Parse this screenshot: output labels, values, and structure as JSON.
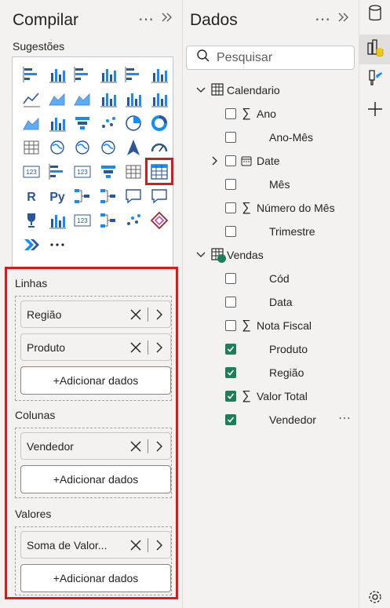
{
  "compilar": {
    "title": "Compilar",
    "suggestions_label": "Sugestões",
    "more_label": "⋯",
    "sections": {
      "linhas": {
        "label": "Linhas",
        "fields": [
          "Região",
          "Produto"
        ]
      },
      "colunas": {
        "label": "Colunas",
        "fields": [
          "Vendedor"
        ]
      },
      "valores": {
        "label": "Valores",
        "fields": [
          "Soma de Valor..."
        ]
      }
    },
    "add_data_label": "+Adicionar dados"
  },
  "dados": {
    "title": "Dados",
    "search_placeholder": "Pesquisar",
    "tables": [
      {
        "name": "Calendario",
        "fields": [
          {
            "name": "Ano",
            "sigma": true,
            "checked": false
          },
          {
            "name": "Ano-Mês",
            "sigma": false,
            "checked": false
          },
          {
            "name": "Date",
            "sigma": false,
            "checked": false,
            "hierarchy": true
          },
          {
            "name": "Mês",
            "sigma": false,
            "checked": false
          },
          {
            "name": "Número do Mês",
            "sigma": true,
            "checked": false
          },
          {
            "name": "Trimestre",
            "sigma": false,
            "checked": false
          }
        ]
      },
      {
        "name": "Vendas",
        "fields": [
          {
            "name": "Cód",
            "sigma": false,
            "checked": false
          },
          {
            "name": "Data",
            "sigma": false,
            "checked": false
          },
          {
            "name": "Nota Fiscal",
            "sigma": true,
            "checked": false
          },
          {
            "name": "Produto",
            "sigma": false,
            "checked": true
          },
          {
            "name": "Região",
            "sigma": false,
            "checked": true
          },
          {
            "name": "Valor Total",
            "sigma": true,
            "checked": true
          },
          {
            "name": "Vendedor",
            "sigma": false,
            "checked": true
          }
        ]
      }
    ]
  },
  "colors": {
    "accent_green": "#1e7d5a",
    "highlight_red": "#d71b1b",
    "viz_blue": "#2b579a",
    "viz_teal": "#118dff"
  },
  "viz_icons": [
    "stacked-bar-icon",
    "stacked-column-icon",
    "clustered-bar-icon",
    "clustered-column-icon",
    "100-stacked-bar-icon",
    "100-stacked-column-icon",
    "line-chart-icon",
    "area-chart-icon",
    "stacked-area-icon",
    "line-stacked-column-icon",
    "line-clustered-column-icon",
    "ribbon-chart-icon",
    "ribbon-icon",
    "waterfall-icon",
    "funnel-icon",
    "scatter-icon",
    "pie-chart-icon",
    "donut-chart-icon",
    "treemap-icon",
    "map-icon",
    "filled-map-icon",
    "shape-map-icon",
    "azure-map-icon",
    "gauge-icon",
    "card-icon",
    "multi-row-card-icon",
    "kpi-icon",
    "slicer-icon",
    "table-icon",
    "matrix-icon",
    "r-visual-icon",
    "python-visual-icon",
    "key-influencers-icon",
    "decomposition-tree-icon",
    "qa-icon",
    "smart-narrative-icon",
    "goals-icon",
    "paginated-report-icon",
    "power-apps-icon",
    "power-automate-icon",
    "arcgis-icon",
    "diamond-visual-icon",
    "power-automate-chevron-icon",
    "more-visuals-icon"
  ]
}
